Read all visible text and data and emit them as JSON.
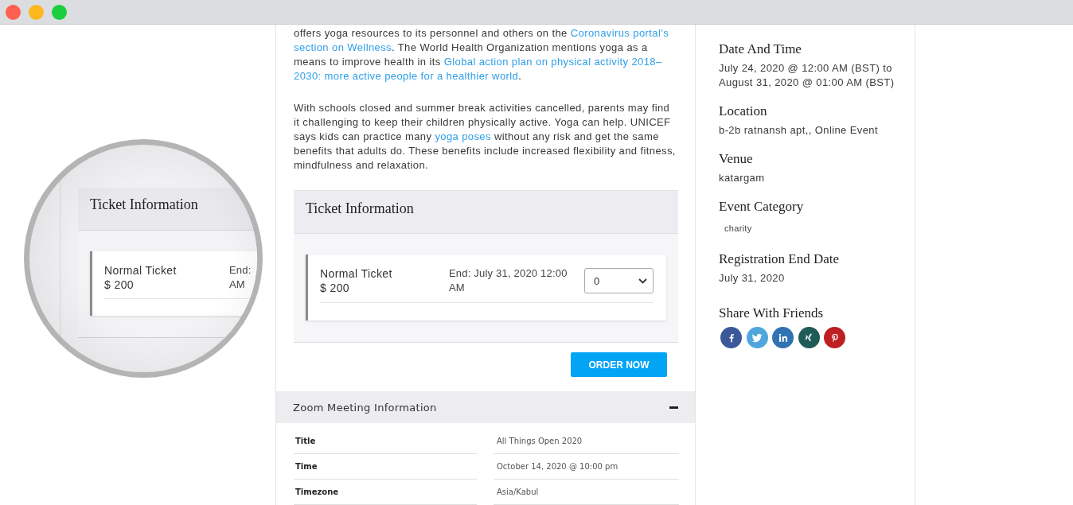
{
  "window": {
    "buttons": [
      {
        "color": "#fd5f50"
      },
      {
        "color": "#fdb820"
      },
      {
        "color": "#1bce3e"
      }
    ]
  },
  "magnifier": {
    "title": "Ticket Information",
    "ticket_name": "Normal Ticket",
    "price": "$ 200",
    "end_lines": [
      "End:",
      "AM"
    ]
  },
  "article": {
    "paragraphs": [
      {
        "segments": [
          {
            "kind": "text",
            "text": "offers yoga resources to its personnel and others on the "
          },
          {
            "kind": "link",
            "text": "Coronavirus portal’s"
          },
          {
            "kind": "link",
            "text": "section on Wellness",
            "spaced": true
          },
          {
            "kind": "text",
            "text": ". The World Health Organization mentions yoga as a means to improve health in its "
          },
          {
            "kind": "link",
            "text": "Global action plan on physical activity 2018–"
          },
          {
            "kind": "link",
            "text": "2030: more active people for a healthier world"
          },
          {
            "kind": "text",
            "text": "."
          }
        ]
      },
      {
        "segments": [
          {
            "kind": "text",
            "text": "With schools closed and summer break activities cancelled, parents may find it challenging to keep their children physically active. Yoga can help. UNICEF says kids can practice many "
          },
          {
            "kind": "link",
            "text": "yoga poses"
          },
          {
            "kind": "text",
            "text": " without any risk and get the same benefits that adults do. These benefits include increased flexibility and fitness, mindfulness and relaxation."
          }
        ]
      }
    ]
  },
  "tickets": {
    "title": "Ticket Information",
    "items": [
      {
        "name": "Normal Ticket",
        "price": "$ 200",
        "end": "End: July 31, 2020 12:00 AM",
        "quantity": "0"
      }
    ],
    "order_button": "ORDER NOW"
  },
  "zoom_meeting": {
    "title": "Zoom Meeting Information",
    "expanded": true,
    "rows": [
      {
        "label": "Title",
        "value": "All Things Open 2020"
      },
      {
        "label": "Time",
        "value": "October 14, 2020 @ 10:00 pm"
      },
      {
        "label": "Timezone",
        "value": "Asia/Kabul"
      }
    ]
  },
  "sidebar": {
    "sections": [
      {
        "kind": "text",
        "heading": "Date And Time",
        "text": "July 24, 2020 @ 12:00 AM (BST) to August 31, 2020 @ 01:00 AM (BST)"
      },
      {
        "kind": "text",
        "heading": "Location",
        "text": "b-2b ratnansh apt,, Online Event"
      },
      {
        "kind": "text",
        "heading": "Venue",
        "text": "katargam"
      },
      {
        "kind": "tags",
        "heading": "Event Category",
        "tags": [
          "charity"
        ]
      },
      {
        "kind": "text",
        "heading": "Registration End Date",
        "text": "July 31, 2020"
      },
      {
        "kind": "share",
        "heading": "Share With Friends",
        "buttons": [
          {
            "kind": "facebook",
            "color": "#3b5998"
          },
          {
            "kind": "twitter",
            "color": "#4ea6dc"
          },
          {
            "kind": "linkedin",
            "color": "#3172b2"
          },
          {
            "kind": "xing",
            "color": "#1f5b58"
          },
          {
            "kind": "pinterest",
            "color": "#bd1f22"
          }
        ]
      }
    ]
  }
}
